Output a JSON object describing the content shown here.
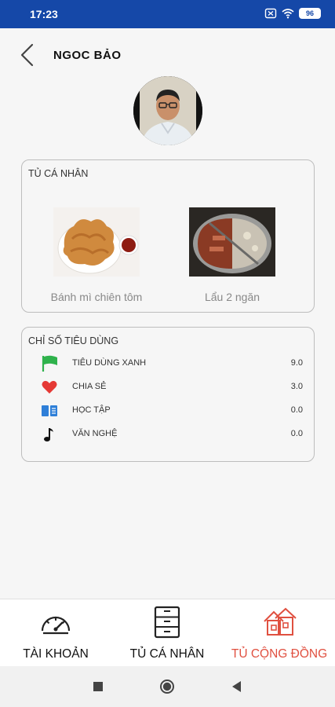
{
  "status_bar": {
    "time": "17:23",
    "battery": "96"
  },
  "header": {
    "title": "NGOC BẢO"
  },
  "personal_cabinet": {
    "title": "TỦ CÁ NHÂN",
    "items": [
      {
        "name": "Bánh mì chiên tôm"
      },
      {
        "name": "Lẩu 2 ngăn"
      }
    ]
  },
  "consumption_index": {
    "title": "CHỈ SỐ TIÊU DÙNG",
    "rows": [
      {
        "label": "TIÊU DÙNG XANH",
        "value": "9.0",
        "icon": "green-flag-icon",
        "color": "#2fb24c"
      },
      {
        "label": "CHIA SẺ",
        "value": "3.0",
        "icon": "heart-icon",
        "color": "#e53935"
      },
      {
        "label": "HỌC TẬP",
        "value": "0.0",
        "icon": "book-icon",
        "color": "#2f7fd8"
      },
      {
        "label": "VĂN NGHỆ",
        "value": "0.0",
        "icon": "music-note-icon",
        "color": "#111111"
      }
    ]
  },
  "bottom_nav": [
    {
      "label": "TÀI KHOẢN",
      "icon": "speedometer-icon"
    },
    {
      "label": "TỦ CÁ NHÂN",
      "icon": "cabinet-icon"
    },
    {
      "label": "TỦ CỘNG ĐỒNG",
      "icon": "community-house-icon",
      "active": true
    }
  ],
  "colors": {
    "status_bar": "#1548a8",
    "active_nav": "#e05040"
  }
}
